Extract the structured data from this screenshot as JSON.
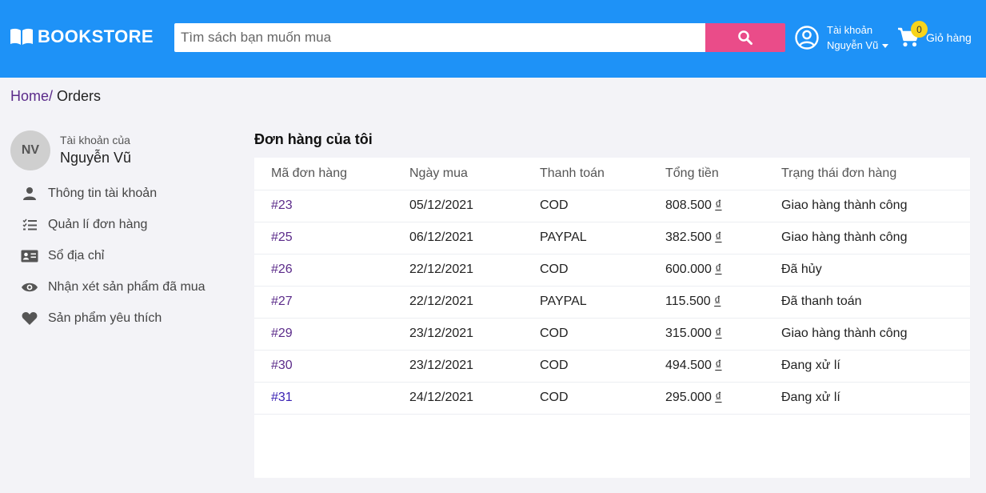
{
  "header": {
    "logo_text": "BOOKSTORE",
    "search_placeholder": "Tìm sách bạn muốn mua",
    "account_label": "Tài khoản",
    "account_name": "Nguyễn Vũ",
    "cart_count": "0",
    "cart_label": "Giỏ hàng"
  },
  "breadcrumb": {
    "home": "Home/",
    "current": "Orders"
  },
  "sidebar": {
    "avatar_initials": "NV",
    "account_of_label": "Tài khoản của",
    "user_name": "Nguyễn Vũ",
    "items": [
      {
        "label": "Thông tin tài khoản",
        "icon": "user-icon"
      },
      {
        "label": "Quản lí đơn hàng",
        "icon": "list-check-icon"
      },
      {
        "label": "Sổ địa chỉ",
        "icon": "address-card-icon"
      },
      {
        "label": "Nhận xét sản phẩm đã mua",
        "icon": "eye-icon"
      },
      {
        "label": "Sản phẩm yêu thích",
        "icon": "heart-icon"
      }
    ]
  },
  "orders": {
    "title": "Đơn hàng của tôi",
    "columns": [
      "Mã đơn hàng",
      "Ngày mua",
      "Thanh toán",
      "Tổng tiền",
      "Trạng thái đơn hàng"
    ],
    "currency_symbol": "₫",
    "rows": [
      {
        "id": "#23",
        "date": "05/12/2021",
        "payment": "COD",
        "total": "808.500",
        "status": "Giao hàng thành công"
      },
      {
        "id": "#25",
        "date": "06/12/2021",
        "payment": "PAYPAL",
        "total": "382.500",
        "status": "Giao hàng thành công"
      },
      {
        "id": "#26",
        "date": "22/12/2021",
        "payment": "COD",
        "total": "600.000",
        "status": "Đã hủy"
      },
      {
        "id": "#27",
        "date": "22/12/2021",
        "payment": "PAYPAL",
        "total": "115.500",
        "status": "Đã thanh toán"
      },
      {
        "id": "#29",
        "date": "23/12/2021",
        "payment": "COD",
        "total": "315.000",
        "status": "Giao hàng thành công"
      },
      {
        "id": "#30",
        "date": "23/12/2021",
        "payment": "COD",
        "total": "494.500",
        "status": "Đang xử lí"
      },
      {
        "id": "#31",
        "date": "24/12/2021",
        "payment": "COD",
        "total": "295.000",
        "status": "Đang xử lí"
      }
    ]
  },
  "colors": {
    "header_bg": "#1e92f7",
    "search_button": "#ea4c89",
    "cart_badge": "#f8d41b",
    "link": "#5b2b8a",
    "page_bg": "#f3f3f7"
  }
}
